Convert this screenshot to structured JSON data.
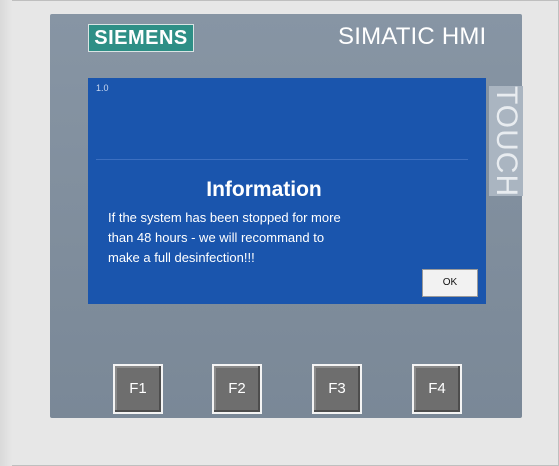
{
  "device": {
    "brand": "SIEMENS",
    "model": "SIMATIC HMI",
    "side_label": "TOUCH",
    "colors": {
      "brand_green": "#2e8f86",
      "panel_gray": "#8795a4",
      "screen_blue": "#1a55ad"
    }
  },
  "screen": {
    "version": "1.0",
    "dialog": {
      "title": "Information",
      "message_lines": [
        "If the system has been stopped for more",
        "than 48 hours - we will recommand to",
        "make a full desinfection!!!"
      ],
      "ok_label": "OK"
    }
  },
  "function_keys": [
    {
      "label": "F1"
    },
    {
      "label": "F2"
    },
    {
      "label": "F3"
    },
    {
      "label": "F4"
    }
  ]
}
